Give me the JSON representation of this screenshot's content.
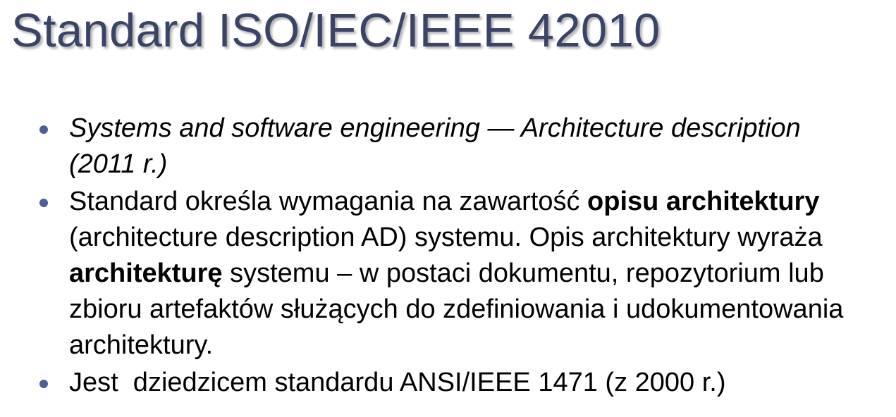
{
  "slide": {
    "title": "Standard ISO/IEC/IEEE 42010",
    "bullets": [
      {
        "line1": "Systems and software engineering — Architecture description",
        "line2": "(2011 r.)"
      },
      {
        "p1": "Standard określa wymagania na zawartość ",
        "b1": "opisu architektury",
        "p2": " (architecture description AD) systemu. Opis architektury wyraża ",
        "b2": "architekturę",
        "p3": " systemu – w postaci dokumentu, repozytorium lub zbioru artefaktów służących do zdefiniowania i udokumentowania architektury."
      },
      {
        "text": "Jest  dziedzicem standardu ANSI/IEEE 1471 (z 2000 r.)"
      }
    ]
  },
  "colors": {
    "title": "#3a4466",
    "bullet_marker": "#4e5e98",
    "body_text": "#000000",
    "background": "#ffffff"
  }
}
